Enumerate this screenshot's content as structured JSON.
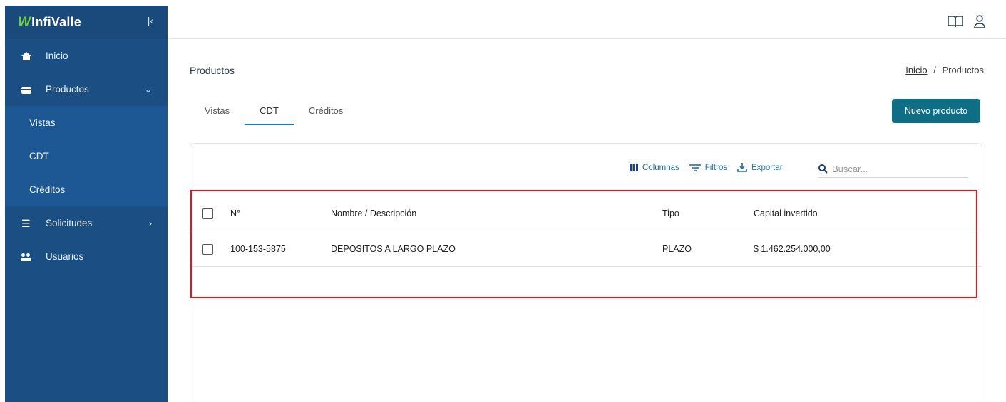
{
  "brand": {
    "logo_mark": "W",
    "logo_text": "InfiValle",
    "collapse_icon": "collapse-left-icon"
  },
  "sidebar": {
    "items": [
      {
        "label": "Inicio",
        "icon": "home-icon"
      },
      {
        "label": "Productos",
        "icon": "box-icon",
        "chevron": "⌄"
      },
      {
        "label": "Solicitudes",
        "icon": "list-icon",
        "chevron": "›"
      },
      {
        "label": "Usuarios",
        "icon": "users-icon"
      }
    ],
    "sub_items": [
      "Vistas",
      "CDT",
      "Créditos"
    ]
  },
  "header": {
    "title": "Productos",
    "breadcrumb": {
      "root": "Inicio",
      "separator": "/",
      "current": "Productos"
    }
  },
  "tabs": [
    "Vistas",
    "CDT",
    "Créditos"
  ],
  "active_tab": "CDT",
  "new_button": "Nuevo producto",
  "toolbar": {
    "columns": "Columnas",
    "filters": "Filtros",
    "export": "Exportar",
    "search_placeholder": "Buscar..."
  },
  "table": {
    "headers": [
      "N°",
      "Nombre / Descripción",
      "Tipo",
      "Capital invertido"
    ],
    "rows": [
      {
        "no": "100-153-5875",
        "name": "DEPOSITOS A LARGO PLAZO",
        "tipo": "PLAZO",
        "capital": "$ 1.462.254.000,00"
      }
    ]
  },
  "colors": {
    "sidebar": "#1b4f84",
    "accent": "#0e6e86",
    "highlight": "#e3161d",
    "logo_green": "#6fcf3e"
  }
}
